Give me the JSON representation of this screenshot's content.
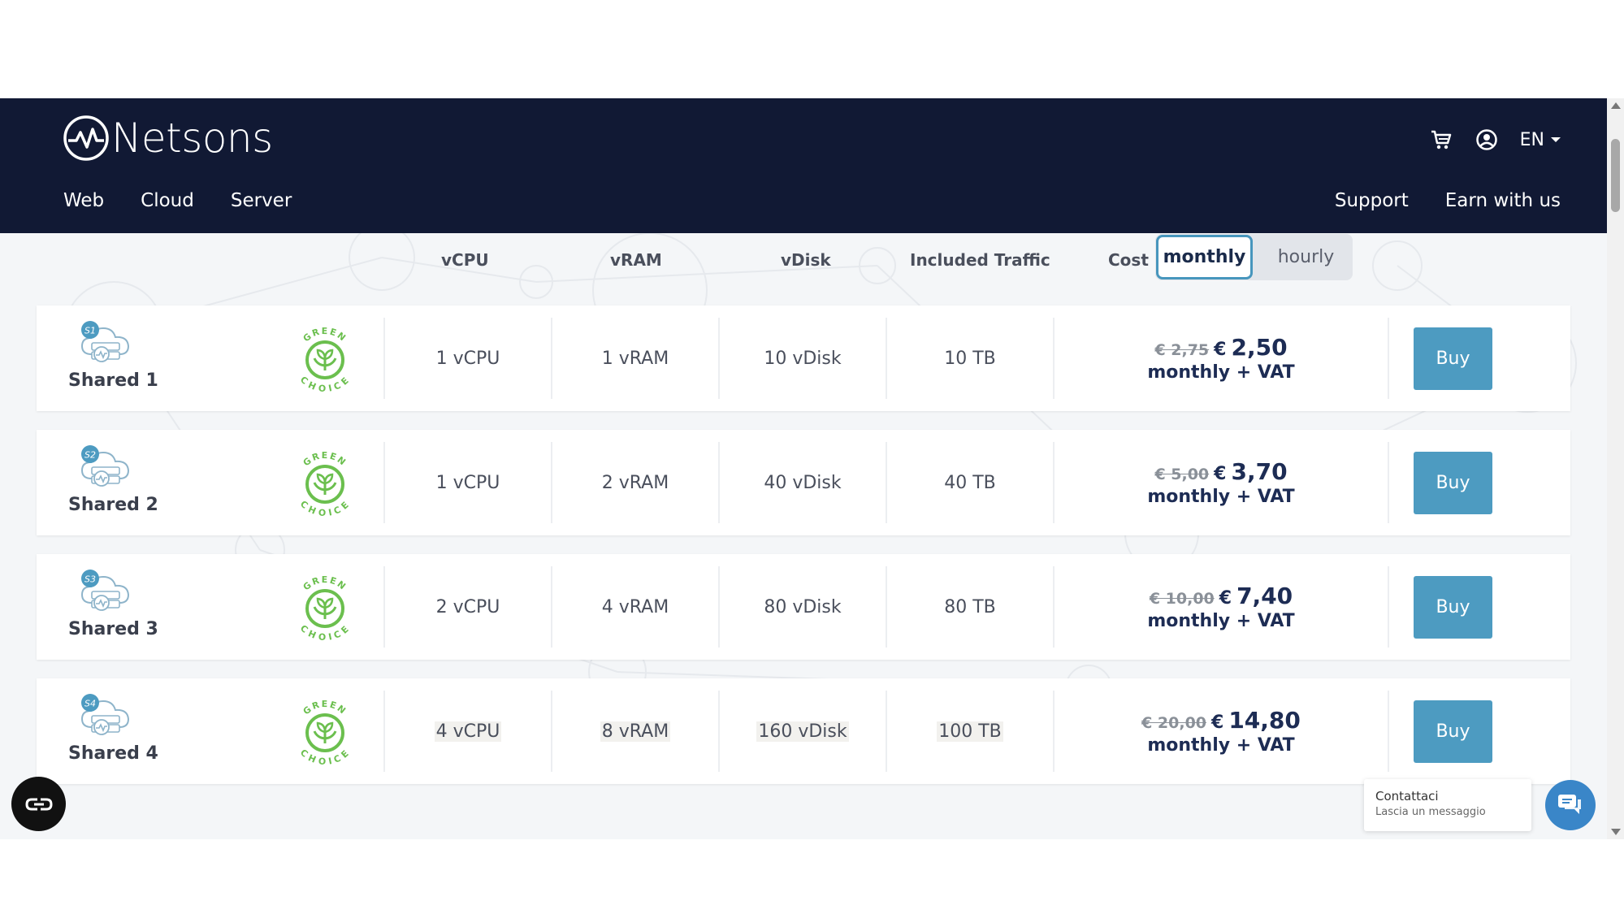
{
  "brand": {
    "name": "Netsons"
  },
  "nav": {
    "left": [
      {
        "label": "Web"
      },
      {
        "label": "Cloud"
      },
      {
        "label": "Server"
      }
    ],
    "right": [
      {
        "label": "Support"
      },
      {
        "label": "Earn with us"
      }
    ],
    "language": "EN",
    "icons": [
      "cart-icon",
      "user-account-icon"
    ]
  },
  "table": {
    "headers": {
      "vcpu": "vCPU",
      "vram": "vRAM",
      "vdisk": "vDisk",
      "traffic": "Included Traffic",
      "cost": "Cost"
    },
    "billing_toggle": {
      "monthly": "monthly",
      "hourly": "hourly",
      "selected": "monthly"
    },
    "green_badge": {
      "top": "GREEN",
      "bottom": "CHOICE"
    },
    "buy_label": "Buy",
    "rows": [
      {
        "badge": "S1",
        "name": "Shared 1",
        "vcpu": "1 vCPU",
        "vram": "1 vRAM",
        "vdisk": "10 vDisk",
        "traffic": "10 TB",
        "old_price": "€ 2,75",
        "currency": "€",
        "price": "2,50",
        "period": "monthly + VAT"
      },
      {
        "badge": "S2",
        "name": "Shared 2",
        "vcpu": "1 vCPU",
        "vram": "2 vRAM",
        "vdisk": "40 vDisk",
        "traffic": "40 TB",
        "old_price": "€ 5,00",
        "currency": "€",
        "price": "3,70",
        "period": "monthly + VAT"
      },
      {
        "badge": "S3",
        "name": "Shared 3",
        "vcpu": "2 vCPU",
        "vram": "4 vRAM",
        "vdisk": "80 vDisk",
        "traffic": "80 TB",
        "old_price": "€ 10,00",
        "currency": "€",
        "price": "7,40",
        "period": "monthly + VAT"
      },
      {
        "badge": "S4",
        "name": "Shared 4",
        "vcpu": "4 vCPU",
        "vram": "8 vRAM",
        "vdisk": "160 vDisk",
        "traffic": "100 TB",
        "old_price": "€ 20,00",
        "currency": "€",
        "price": "14,80",
        "period": "monthly + VAT"
      }
    ]
  },
  "chat": {
    "title": "Contattaci",
    "subtitle": "Lascia un messaggio"
  },
  "colors": {
    "header_bg": "#111934",
    "accent": "#4d9bc1",
    "price": "#1d2c54",
    "green": "#6bbf4e"
  }
}
